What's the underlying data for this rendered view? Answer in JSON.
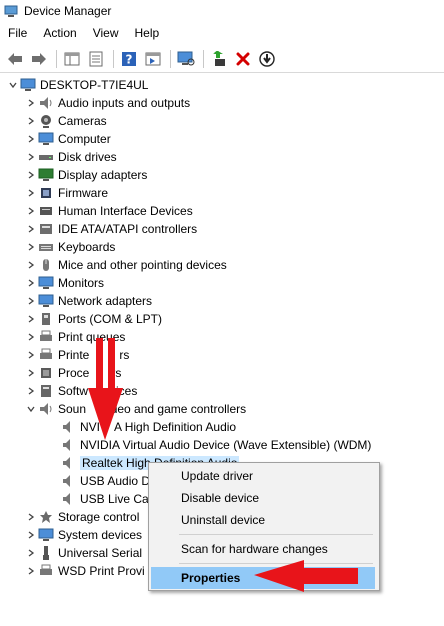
{
  "window": {
    "title": "Device Manager"
  },
  "menu": [
    "File",
    "Action",
    "View",
    "Help"
  ],
  "toolbar": {
    "icons": [
      "back-arrow-icon",
      "forward-arrow-icon",
      "show-hide-console-tree-icon",
      "properties-icon",
      "help-icon",
      "action-pane-icon",
      "scan-hardware-icon",
      "update-driver-icon",
      "uninstall-icon",
      "disable-device-icon"
    ]
  },
  "tree": {
    "root": "DESKTOP-T7IE4UL",
    "categories": [
      "Audio inputs and outputs",
      "Cameras",
      "Computer",
      "Disk drives",
      "Display adapters",
      "Firmware",
      "Human Interface Devices",
      "IDE ATA/ATAPI controllers",
      "Keyboards",
      "Mice and other pointing devices",
      "Monitors",
      "Network adapters",
      "Ports (COM & LPT)",
      "Print queues",
      "Printers",
      "Processors",
      "Software devices",
      "Sound, video and game controllers"
    ],
    "sound_children": [
      "NVIDIA High Definition Audio",
      "NVIDIA Virtual Audio Device (Wave Extensible) (WDM)",
      "Realtek High Definition Audio",
      "USB Audio Device",
      "USB Live Camera"
    ],
    "after": [
      "Storage controllers",
      "System devices",
      "Universal Serial Bus controllers",
      "WSD Print Provider"
    ],
    "visible_text": {
      "print_queues": "Print queues",
      "printers": "Printe",
      "processors": "Proce",
      "software": "Softw",
      "sound": "Soun",
      "sound_tail": "ideo and game controllers",
      "nvidia_hd": "NVI",
      "nvidia_hd_tail": "A High Definition Audio",
      "nvidia_virtual": "NVIDIA Virtual Audio Device (Wave Extensible) (WDM)",
      "realtek": "Realtek High Definition Audio",
      "usb_audio": "USB Audio D",
      "usb_live": "USB Live Ca",
      "storage": "Storage control",
      "system": "System devices",
      "usb_controllers": "Universal Serial",
      "wsd": "WSD Print Provi",
      "software_tail": "vices",
      "processors_tail": "rs",
      "printers_tail": "rs"
    }
  },
  "context_menu": {
    "items": [
      "Update driver",
      "Disable device",
      "Uninstall device",
      "Scan for hardware changes",
      "Properties"
    ],
    "highlighted": "Properties"
  },
  "annotation_color": "#e8141a",
  "selection_color": "#cce8ff",
  "menu_highlight_color": "#91c9f7"
}
